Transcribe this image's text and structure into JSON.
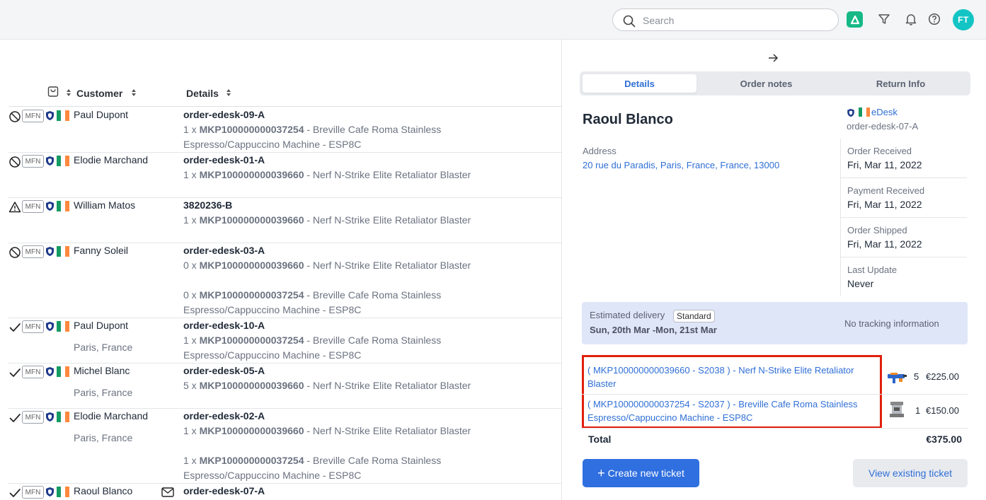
{
  "topbar": {
    "search_placeholder": "Search",
    "avatar_initials": "FT",
    "icons": [
      "search-icon",
      "brand-app-icon",
      "filter-icon",
      "bell-icon",
      "help-icon"
    ]
  },
  "table": {
    "columns": {
      "customer": "Customer",
      "details": "Details"
    },
    "rows": [
      {
        "status": "blocked",
        "badge": "MFN",
        "name": "Paul Dupont",
        "location": "",
        "order": "order-edesk-09-A",
        "items": [
          {
            "qty": "1 x",
            "sku": "MKP100000000037254",
            "desc": "- Breville Cafe Roma Stainless Espresso/Cappuccino Machine - ESP8C"
          }
        ]
      },
      {
        "status": "blocked",
        "badge": "MFN",
        "name": "Elodie Marchand",
        "location": "",
        "order": "order-edesk-01-A",
        "items": [
          {
            "qty": "1 x",
            "sku": "MKP100000000039660",
            "desc": "- Nerf N-Strike Elite Retaliator Blaster"
          }
        ]
      },
      {
        "status": "warning",
        "badge": "MFN",
        "name": "William Matos",
        "location": "",
        "order": "3820236-B",
        "items": [
          {
            "qty": "1 x",
            "sku": "MKP100000000039660",
            "desc": "- Nerf N-Strike Elite Retaliator Blaster"
          }
        ]
      },
      {
        "status": "blocked",
        "badge": "MFN",
        "name": "Fanny Soleil",
        "location": "",
        "order": "order-edesk-03-A",
        "items": [
          {
            "qty": "0 x",
            "sku": "MKP100000000039660",
            "desc": "- Nerf N-Strike Elite Retaliator Blaster"
          },
          {
            "qty": "0 x",
            "sku": "MKP100000000037254",
            "desc": "- Breville Cafe Roma Stainless Espresso/Cappuccino Machine - ESP8C"
          }
        ]
      },
      {
        "status": "done",
        "badge": "MFN",
        "name": "Paul Dupont",
        "location": "Paris, France",
        "order": "order-edesk-10-A",
        "items": [
          {
            "qty": "1 x",
            "sku": "MKP100000000037254",
            "desc": "- Breville Cafe Roma Stainless Espresso/Cappuccino Machine - ESP8C"
          }
        ]
      },
      {
        "status": "done",
        "badge": "MFN",
        "name": "Michel Blanc",
        "location": "Paris, France",
        "order": "order-edesk-05-A",
        "items": [
          {
            "qty": "5 x",
            "sku": "MKP100000000039660",
            "desc": "- Nerf N-Strike Elite Retaliator Blaster"
          }
        ]
      },
      {
        "status": "done",
        "badge": "MFN",
        "name": "Elodie Marchand",
        "location": "Paris, France",
        "order": "order-edesk-02-A",
        "items": [
          {
            "qty": "1 x",
            "sku": "MKP100000000039660",
            "desc": "- Nerf N-Strike Elite Retaliator Blaster"
          },
          {
            "qty": "1 x",
            "sku": "MKP100000000037254",
            "desc": "- Breville Cafe Roma Stainless Espresso/Cappuccino Machine - ESP8C"
          }
        ]
      },
      {
        "status": "done",
        "badge": "MFN",
        "name": "Raoul Blanco",
        "location": "",
        "order": "order-edesk-07-A",
        "items": []
      }
    ]
  },
  "panel": {
    "tabs": [
      "Details",
      "Order notes",
      "Return Info"
    ],
    "active_tab": "Details",
    "customer_name": "Raoul Blanco",
    "channel_name": "eDesk",
    "channel_order": "order-edesk-07-A",
    "address_label": "Address",
    "address_value": "20 rue du Paradis, Paris, France, France, 13000",
    "info": [
      {
        "label": "Order Received",
        "value": "Fri, Mar 11, 2022"
      },
      {
        "label": "Payment Received",
        "value": "Fri, Mar 11, 2022"
      },
      {
        "label": "Order Shipped",
        "value": "Fri, Mar 11, 2022"
      },
      {
        "label": "Last Update",
        "value": "Never"
      }
    ],
    "delivery": {
      "label": "Estimated delivery",
      "badge": "Standard",
      "range": "Sun, 20th Mar -Mon, 21st Mar",
      "tracking": "No tracking information"
    },
    "line_items": [
      {
        "text": "( MKP100000000039660 - S2038 ) - Nerf N-Strike Elite Retaliator Blaster",
        "qty": "5",
        "price": "€225.00",
        "thumb": "blaster-thumbnail"
      },
      {
        "text": "( MKP100000000037254 - S2037 ) - Breville Cafe Roma Stainless Espresso/Cappuccino Machine - ESP8C",
        "qty": "1",
        "price": "€150.00",
        "thumb": "espresso-machine-thumbnail"
      }
    ],
    "total_label": "Total",
    "total_value": "€375.00",
    "create_button": "Create new ticket",
    "view_button": "View existing ticket"
  },
  "colors": {
    "accent": "#2f6fe0",
    "link": "#2f6fd6",
    "highlight_border": "#e0200c",
    "brand": "#16b985",
    "avatar": "#13c4c4",
    "delivery_bg": "#dfe6f8"
  }
}
